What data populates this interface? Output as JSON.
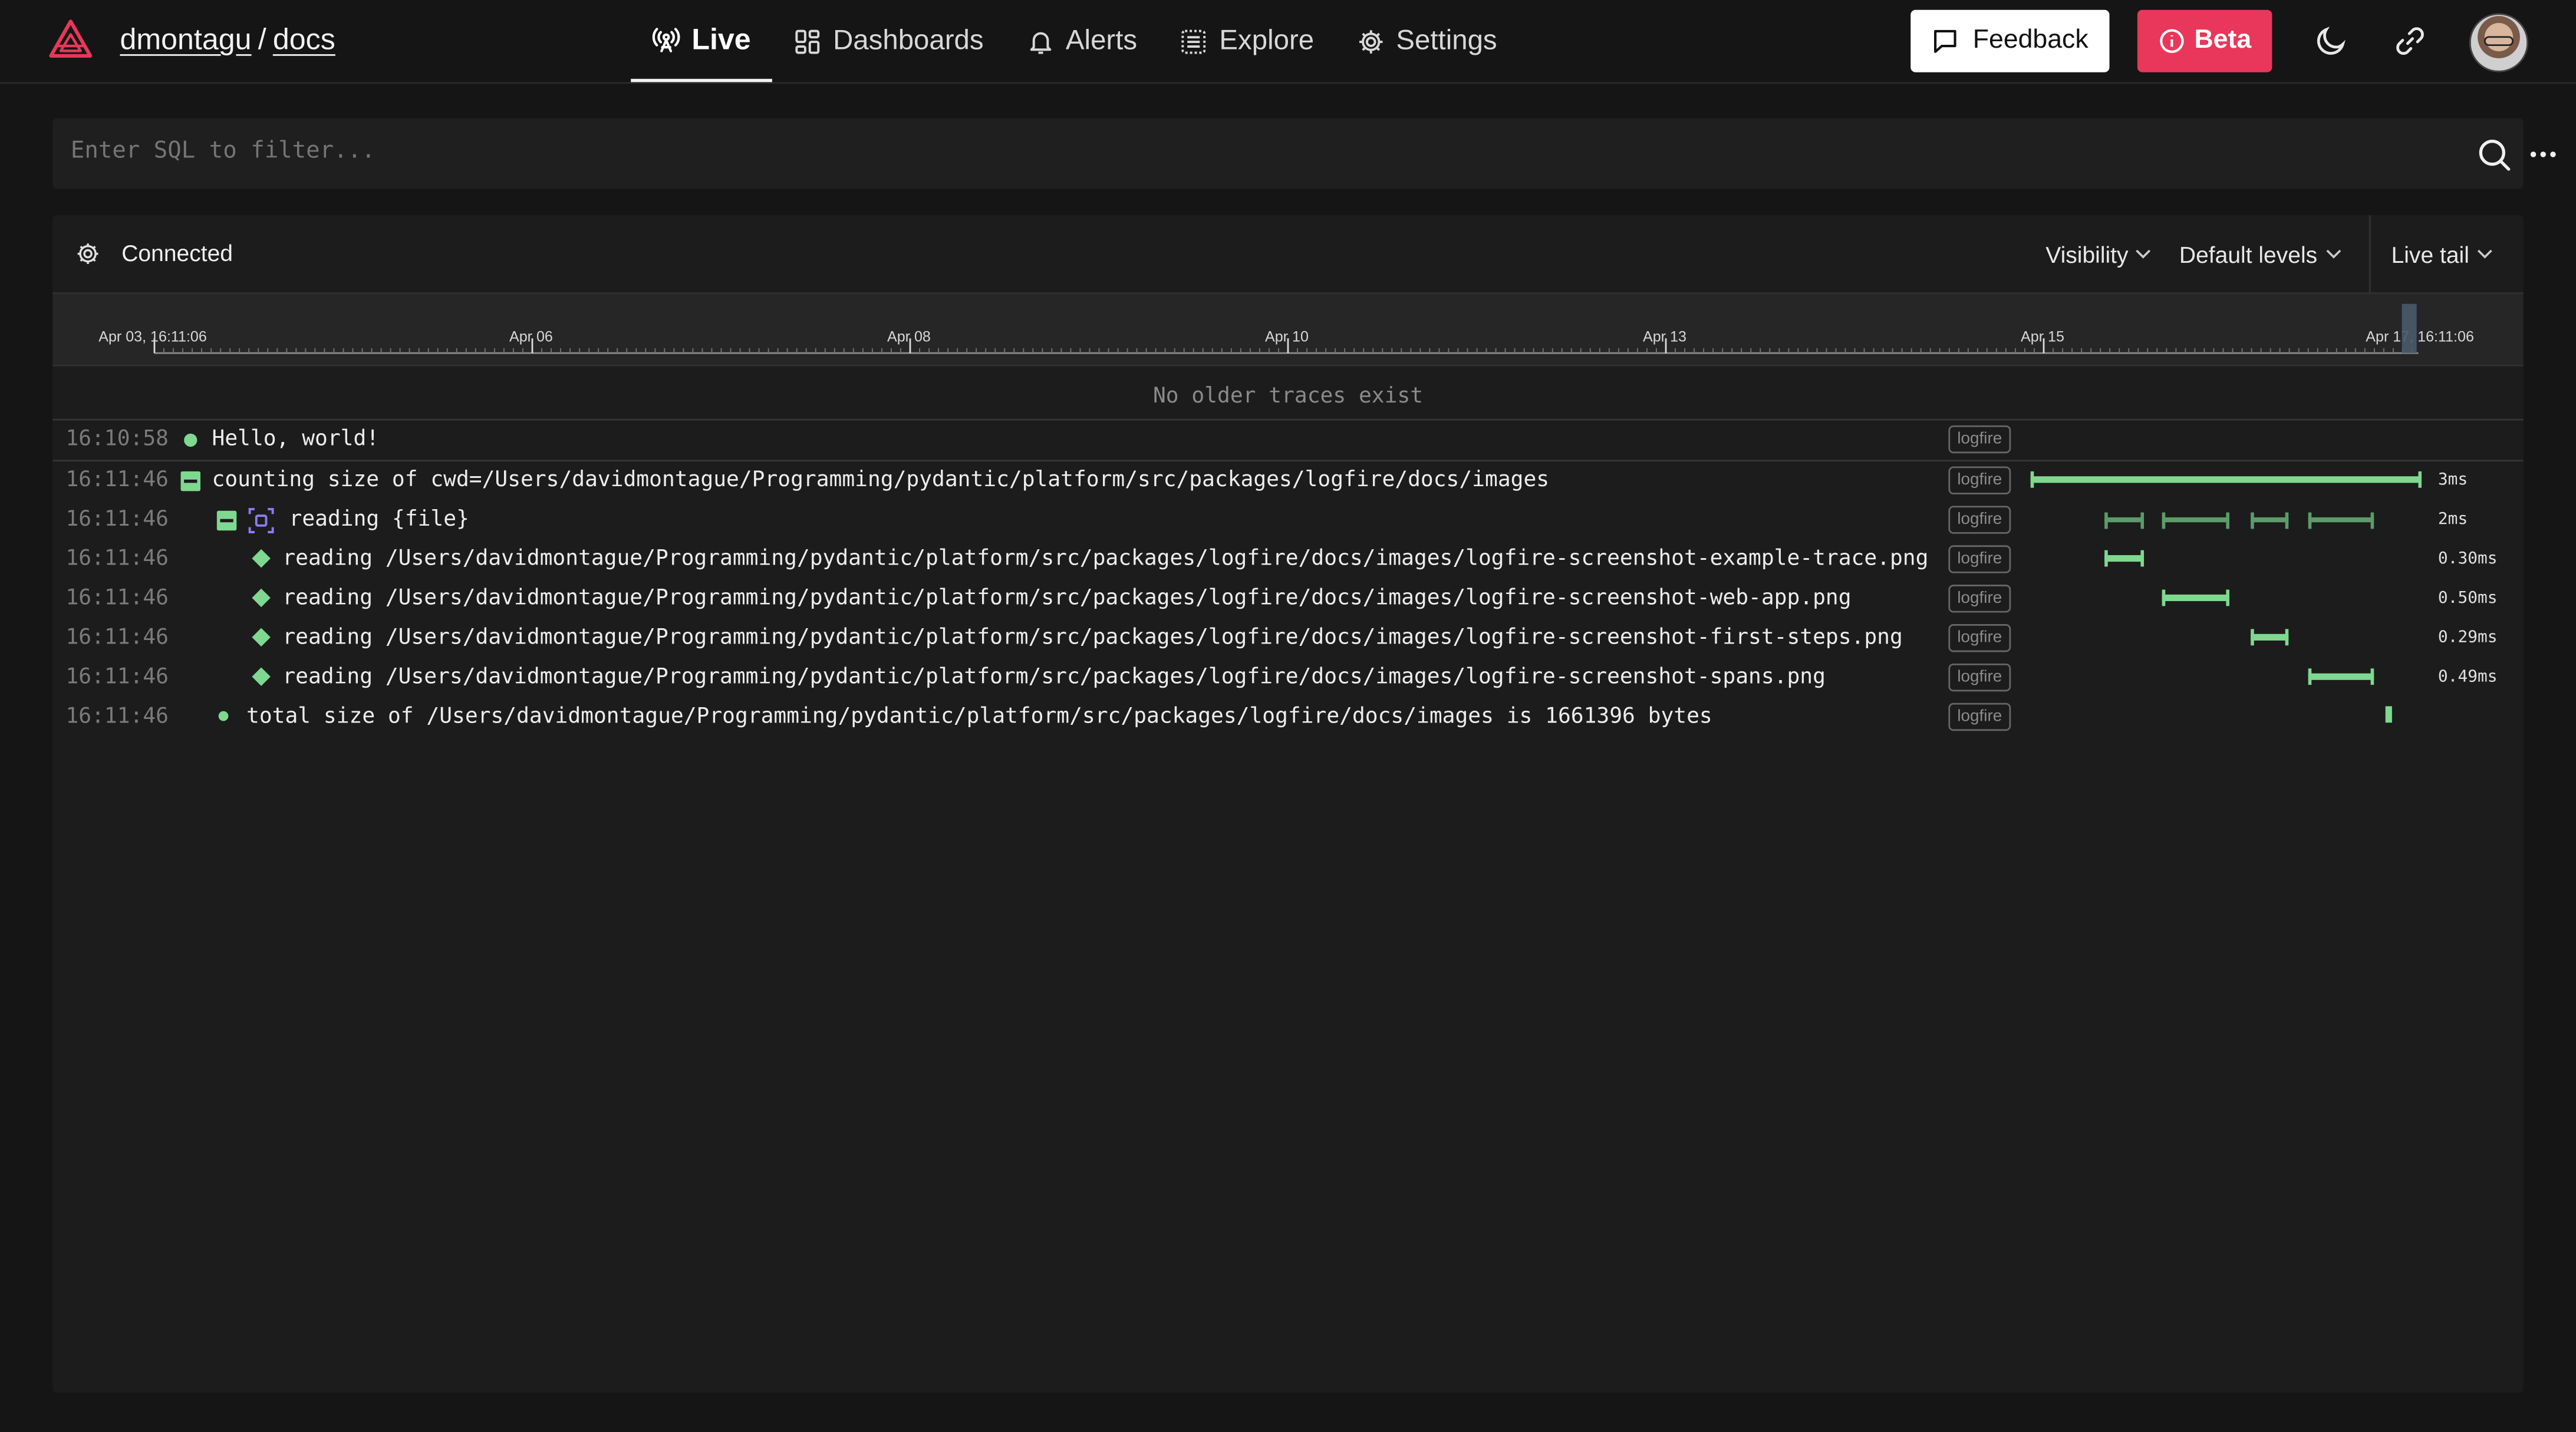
{
  "header": {
    "org": "dmontagu",
    "separator": "/",
    "project": "docs",
    "nav": [
      {
        "label": "Live",
        "icon": "broadcast-icon",
        "active": true
      },
      {
        "label": "Dashboards",
        "icon": "dashboard-grid-icon"
      },
      {
        "label": "Alerts",
        "icon": "bell-icon"
      },
      {
        "label": "Explore",
        "icon": "explore-list-icon"
      },
      {
        "label": "Settings",
        "icon": "gear-icon"
      }
    ],
    "feedback_label": "Feedback",
    "beta_label": "Beta"
  },
  "search": {
    "placeholder": "Enter SQL to filter..."
  },
  "panel": {
    "status": "Connected",
    "visibility_label": "Visibility",
    "levels_label": "Default levels",
    "livetail_label": "Live tail",
    "no_older": "No older traces exist"
  },
  "timeline": {
    "labels": [
      "Apr 03, 16:11:06",
      "Apr 06",
      "Apr 08",
      "Apr 10",
      "Apr 13",
      "Apr 15",
      "Apr 17, 16:11:06"
    ]
  },
  "rows": [
    {
      "time": "16:10:58",
      "message": "Hello, world!",
      "tag": "logfire",
      "marker": "dot"
    },
    {
      "time": "16:11:46",
      "message": "counting size of cwd=/Users/davidmontague/Programming/pydantic/platform/src/packages/logfire/docs/images",
      "tag": "logfire",
      "marker": "collapse",
      "duration": "3ms"
    },
    {
      "time": "16:11:46",
      "message": "reading {file}",
      "tag": "logfire",
      "marker": "collapse",
      "duration": "2ms"
    },
    {
      "time": "16:11:46",
      "message": "reading /Users/davidmontague/Programming/pydantic/platform/src/packages/logfire/docs/images/logfire-screenshot-example-trace.png",
      "tag": "logfire",
      "marker": "diamond",
      "duration": "0.30ms"
    },
    {
      "time": "16:11:46",
      "message": "reading /Users/davidmontague/Programming/pydantic/platform/src/packages/logfire/docs/images/logfire-screenshot-web-app.png",
      "tag": "logfire",
      "marker": "diamond",
      "duration": "0.50ms"
    },
    {
      "time": "16:11:46",
      "message": "reading /Users/davidmontague/Programming/pydantic/platform/src/packages/logfire/docs/images/logfire-screenshot-first-steps.png",
      "tag": "logfire",
      "marker": "diamond",
      "duration": "0.29ms"
    },
    {
      "time": "16:11:46",
      "message": "reading /Users/davidmontague/Programming/pydantic/platform/src/packages/logfire/docs/images/logfire-screenshot-spans.png",
      "tag": "logfire",
      "marker": "diamond",
      "duration": "0.49ms"
    },
    {
      "time": "16:11:46",
      "message": "total size of /Users/davidmontague/Programming/pydantic/platform/src/packages/logfire/docs/images is 1661396 bytes",
      "tag": "logfire",
      "marker": "dot"
    }
  ],
  "colors": {
    "accent": "#7fd88f",
    "beta": "#e8375a",
    "background": "#151515"
  }
}
